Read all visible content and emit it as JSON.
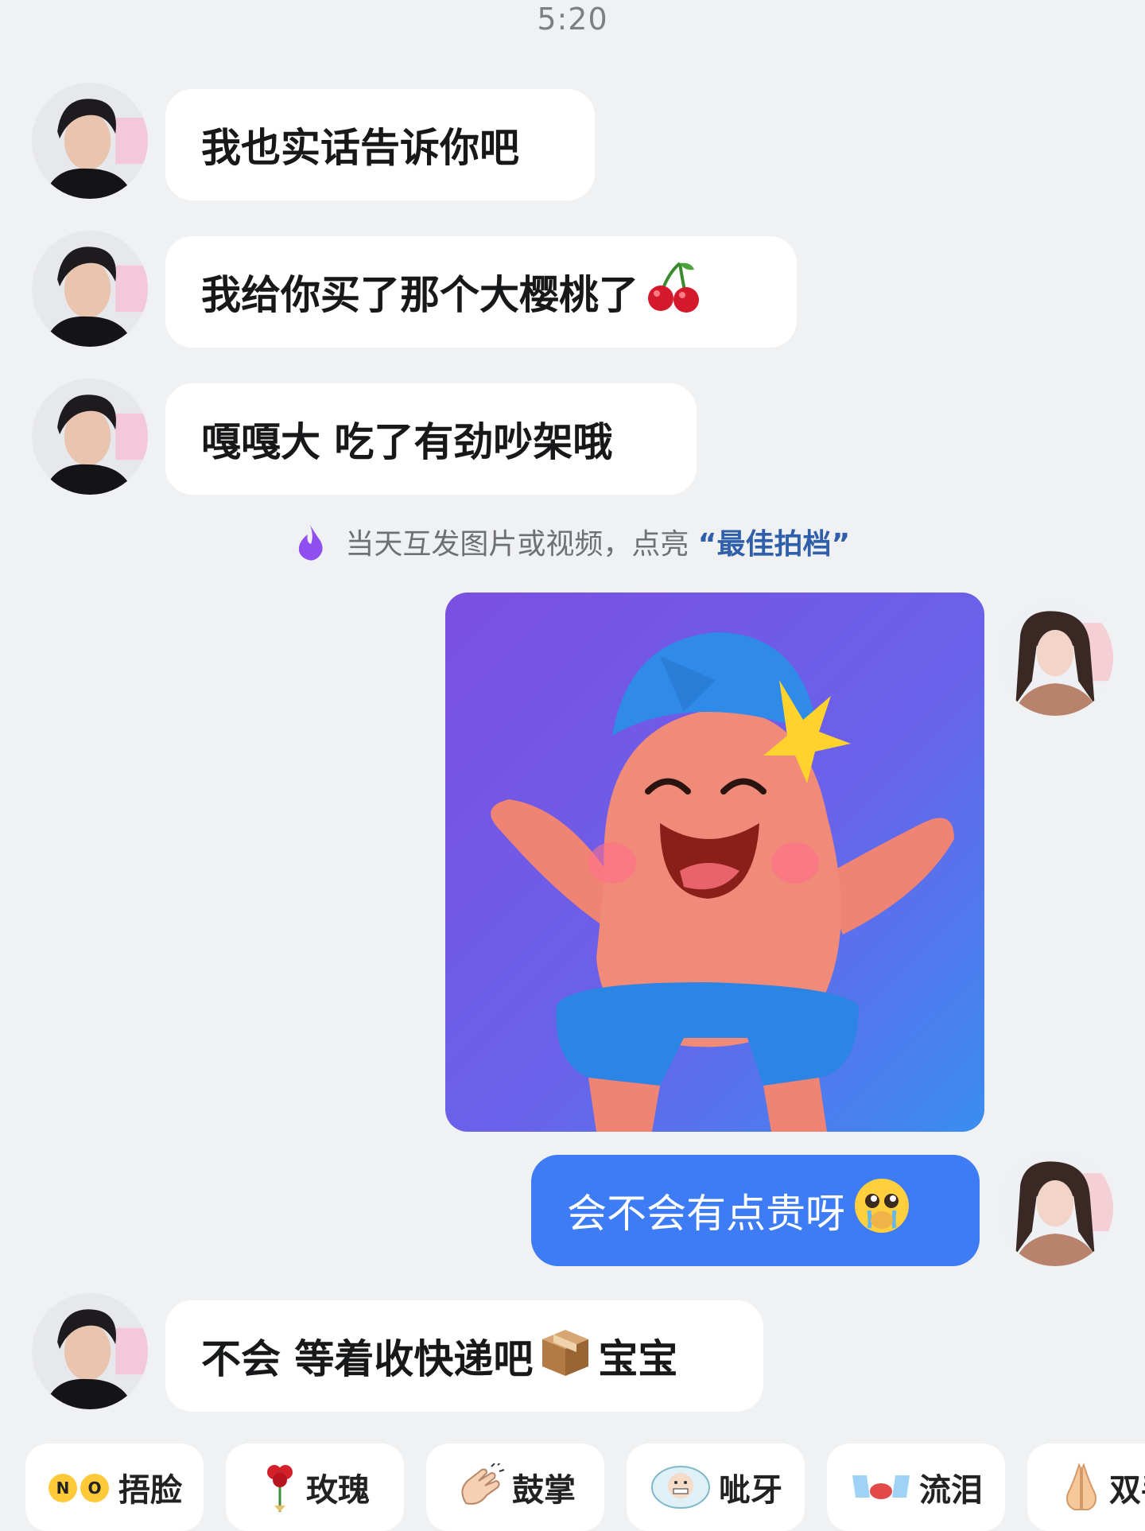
{
  "status_bar": {
    "time": "5:20"
  },
  "messages": [
    {
      "sender": "them",
      "text": "我也实话告诉你吧"
    },
    {
      "sender": "them",
      "text": "我给你买了那个大樱桃了",
      "trailing_icon": "cherry-icon"
    },
    {
      "sender": "them",
      "text": "嘎嘎大 吃了有劲吵架哦"
    },
    {
      "sender": "me",
      "type": "sticker",
      "sticker": "happy-pink-starfish-sticker"
    },
    {
      "sender": "me",
      "text": "会不会有点贵呀",
      "trailing_icon": "pleading-face-icon"
    },
    {
      "sender": "them",
      "text_a": "不会 等着收快递吧",
      "inline_icon": "package-icon",
      "text_b": "宝宝"
    }
  ],
  "system_notice": {
    "icon": "purple-flame-icon",
    "text": "当天互发图片或视频，点亮",
    "highlight": "“最佳拍档”",
    "highlight_color": "#2f5faa"
  },
  "quick_replies": [
    {
      "label": "捂脸",
      "icon": "no-hands-icon"
    },
    {
      "label": "玫瑰",
      "icon": "rose-icon"
    },
    {
      "label": "鼓掌",
      "icon": "clap-icon"
    },
    {
      "label": "呲牙",
      "icon": "grin-icon"
    },
    {
      "label": "流泪",
      "icon": "tears-icon"
    },
    {
      "label": "双手",
      "icon": "pray-icon"
    }
  ],
  "colors": {
    "background": "#f0f1f3",
    "incoming_bubble": "#ffffff",
    "outgoing_bubble": "#3d7cf4"
  }
}
